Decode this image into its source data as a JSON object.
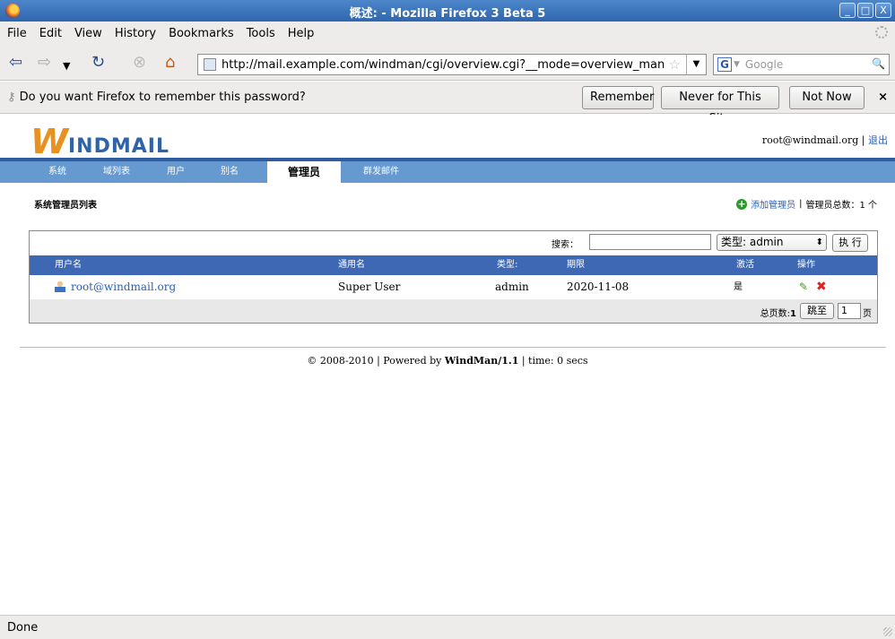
{
  "window": {
    "title": "概述: - Mozilla Firefox 3 Beta 5",
    "controls": [
      "_",
      "□",
      "X"
    ]
  },
  "menu": [
    "File",
    "Edit",
    "View",
    "History",
    "Bookmarks",
    "Tools",
    "Help"
  ],
  "nav": {
    "url": "http://mail.example.com/windman/cgi/overview.cgi?__mode=overview_man",
    "search_placeholder": "Google",
    "search_engine_icon": "G"
  },
  "notification": {
    "message": "Do you want Firefox to remember this password?",
    "remember": "Remember",
    "never": "Never for This Site",
    "not_now": "Not Now",
    "close": "×"
  },
  "page": {
    "logo": {
      "first": "W",
      "rest": "INDMAIL"
    },
    "user_email": "root@windmail.org",
    "separator": "|",
    "logout": "退出",
    "tabs": [
      {
        "label": "系统",
        "active": false
      },
      {
        "label": "域列表",
        "active": false
      },
      {
        "label": "用户",
        "active": false
      },
      {
        "label": "别名",
        "active": false
      },
      {
        "label": "管理员",
        "active": true
      },
      {
        "label": "群发邮件",
        "active": false
      }
    ],
    "section_title": "系统管理员列表",
    "add_admin": "添加管理员",
    "admin_total_label": "管理员总数：1 个",
    "search_label": "搜索：",
    "search_value": "",
    "type_select": "类型: admin",
    "execute_button": "执 行",
    "columns": [
      "用户名",
      "通用名",
      "类型:",
      "期限",
      "激活",
      "操作"
    ],
    "rows": [
      {
        "username": "root@windmail.org",
        "common_name": "Super User",
        "type": "admin",
        "expiry": "2020-11-08",
        "active": "是"
      }
    ],
    "page_total_label": "总页数:",
    "page_total_value": "1",
    "jump_button": "跳至",
    "page_input": "1",
    "page_suffix": "页",
    "footer": {
      "copyright": "© 2008-2010 | Powered by ",
      "product": "WindMan/1.1",
      "time": " | time: 0 secs"
    }
  },
  "status": "Done",
  "colors": {
    "tabbar": "#6599d0",
    "table_header": "#3e68b4",
    "link": "#2b5fb3",
    "logo_orange": "#e8911e",
    "logo_blue": "#2d63a8"
  }
}
